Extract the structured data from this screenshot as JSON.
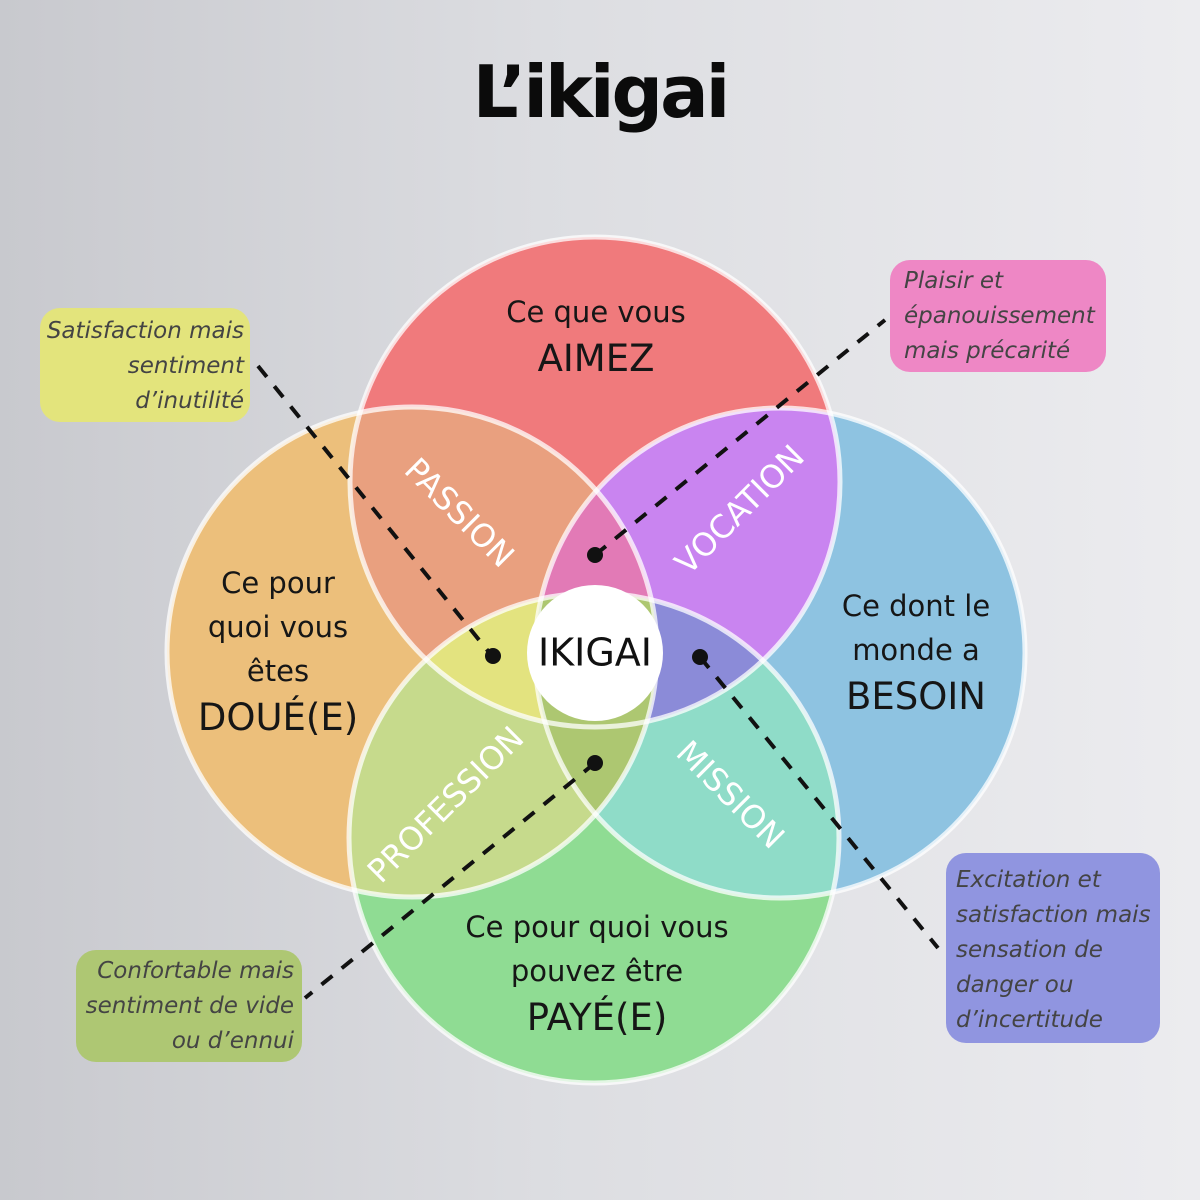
{
  "title": "L’ikigai",
  "circles": {
    "aimez": {
      "lines": [
        "Ce que vous"
      ],
      "keyword": "AIMEZ",
      "color": "#f07a7c"
    },
    "doue": {
      "lines": [
        "Ce pour",
        "quoi vous",
        "êtes"
      ],
      "keyword": "DOUÉ(E)",
      "color": "#ecbf7b"
    },
    "besoin": {
      "lines": [
        "Ce dont le",
        "monde a"
      ],
      "keyword": "BESOIN",
      "color": "#8ec3e1"
    },
    "paye": {
      "lines": [
        "Ce pour quoi vous",
        "pouvez être"
      ],
      "keyword": "PAYÉ(E)",
      "color": "#8fdc93"
    }
  },
  "overlaps": {
    "passion": {
      "label": "PASSION",
      "color": "#e9a07f"
    },
    "vocation": {
      "label": "VOCATION",
      "color": "#c984f0"
    },
    "mission": {
      "label": "MISSION",
      "color": "#8fdcc8"
    },
    "profession": {
      "label": "PROFESSION",
      "color": "#c6da8c"
    }
  },
  "triples": {
    "top": {
      "color": "#e27ab6"
    },
    "left": {
      "color": "#e3e37f"
    },
    "right": {
      "color": "#8b8bd8"
    },
    "bottom": {
      "color": "#adc771"
    }
  },
  "center": {
    "label": "IKIGAI",
    "color": "#ffffff"
  },
  "callouts": {
    "satisfaction": {
      "lines": [
        "Satisfaction mais",
        "sentiment",
        "d’inutilité"
      ],
      "color": "#e3e47c"
    },
    "plaisir": {
      "lines": [
        "Plaisir et",
        "épanouissement",
        "mais précarité"
      ],
      "color": "#ee87c5"
    },
    "confortable": {
      "lines": [
        "Confortable mais",
        "sentiment de vide",
        "ou d’ennui"
      ],
      "color": "#aec773"
    },
    "excitation": {
      "lines": [
        "Excitation et",
        "satisfaction mais",
        "sensation de",
        "danger ou",
        "d’incertitude"
      ],
      "color": "#9095e0"
    }
  }
}
